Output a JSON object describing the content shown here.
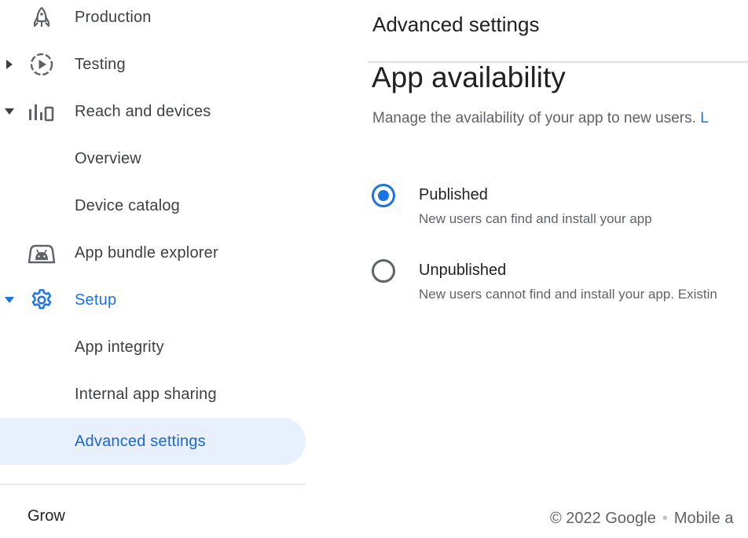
{
  "sidebar": {
    "items": [
      {
        "label": "Production",
        "icon": "rocket-icon"
      },
      {
        "label": "Testing",
        "icon": "play-circle-icon"
      },
      {
        "label": "Reach and devices",
        "icon": "bar-chart-icon"
      },
      {
        "label": "Overview"
      },
      {
        "label": "Device catalog"
      },
      {
        "label": "App bundle explorer",
        "icon": "android-icon"
      },
      {
        "label": "Setup",
        "icon": "gear-icon"
      },
      {
        "label": "App integrity"
      },
      {
        "label": "Internal app sharing"
      },
      {
        "label": "Advanced settings"
      }
    ],
    "grow_label": "Grow"
  },
  "header": {
    "title": "Advanced settings"
  },
  "availability": {
    "title": "App availability",
    "description": "Manage the availability of your app to new users.",
    "link_text": "L",
    "options": [
      {
        "label": "Published",
        "sublabel": "New users can find and install your app",
        "selected": true
      },
      {
        "label": "Unpublished",
        "sublabel": "New users cannot find and install your app. Existin",
        "selected": false
      }
    ]
  },
  "footer": {
    "copyright": "© 2022 Google",
    "separator": "•",
    "link": "Mobile a"
  },
  "colors": {
    "accent": "#1a73e8",
    "active_bg": "#e8f0fe",
    "text_secondary": "#5f6368"
  }
}
